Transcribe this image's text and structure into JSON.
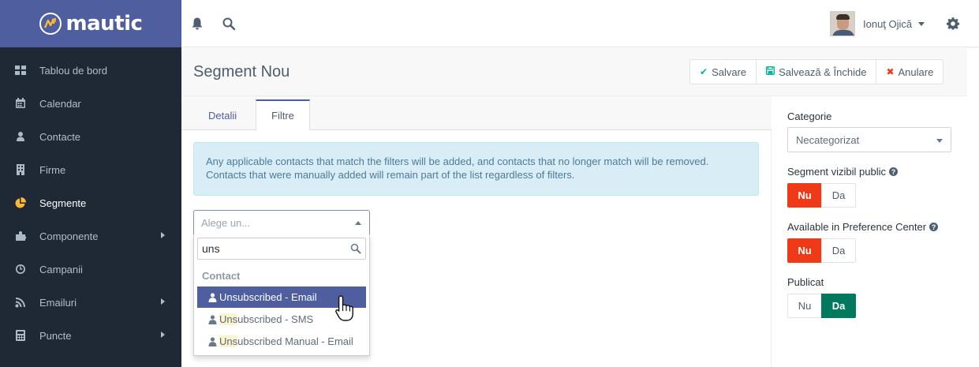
{
  "brand": {
    "name": "mautic"
  },
  "sidebar": {
    "items": [
      {
        "label": "Tablou de bord",
        "icon": "dashboard-icon"
      },
      {
        "label": "Calendar",
        "icon": "calendar-icon"
      },
      {
        "label": "Contacte",
        "icon": "user-icon"
      },
      {
        "label": "Firme",
        "icon": "building-icon"
      },
      {
        "label": "Segmente",
        "icon": "pie-chart-icon",
        "active": true
      },
      {
        "label": "Componente",
        "icon": "puzzle-icon",
        "submenu": true
      },
      {
        "label": "Campanii",
        "icon": "clock-icon"
      },
      {
        "label": "Emailuri",
        "icon": "rss-icon",
        "submenu": true
      },
      {
        "label": "Puncte",
        "icon": "calculator-icon",
        "submenu": true
      }
    ]
  },
  "topbar": {
    "user_name": "Ionuţ Ojică"
  },
  "header": {
    "title": "Segment Nou",
    "save_label": "Salvare",
    "save_close_label": "Salvează & Închide",
    "cancel_label": "Anulare"
  },
  "tabs": [
    {
      "label": "Detalii"
    },
    {
      "label": "Filtre",
      "active": true
    }
  ],
  "alert": {
    "line1": "Any applicable contacts that match the filters will be added, and contacts that no longer match will be removed.",
    "line2": "Contacts that were manually added will remain part of the list regardless of filters."
  },
  "filter_select": {
    "placeholder": "Alege un...",
    "search_value": "uns",
    "group_label": "Contact",
    "options": [
      {
        "prefix": "Uns",
        "rest": "ubscribed - Email",
        "highlighted": true
      },
      {
        "prefix": "Uns",
        "rest": "ubscribed - SMS"
      },
      {
        "prefix": "Uns",
        "rest": "ubscribed Manual - Email"
      }
    ]
  },
  "right_panel": {
    "category_label": "Categorie",
    "category_value": "Necategorizat",
    "public_label": "Segment vizibil public",
    "pref_center_label": "Available in Preference Center",
    "published_label": "Publicat",
    "no_label": "Nu",
    "yes_label": "Da",
    "public_value": "Nu",
    "pref_center_value": "Nu",
    "published_value": "Da"
  },
  "colors": {
    "brand": "#4e5e9e",
    "sidebar_bg": "#1f2935",
    "active_icon": "#fdb933",
    "toggle_no": "#f03a17",
    "toggle_yes": "#00795e"
  }
}
